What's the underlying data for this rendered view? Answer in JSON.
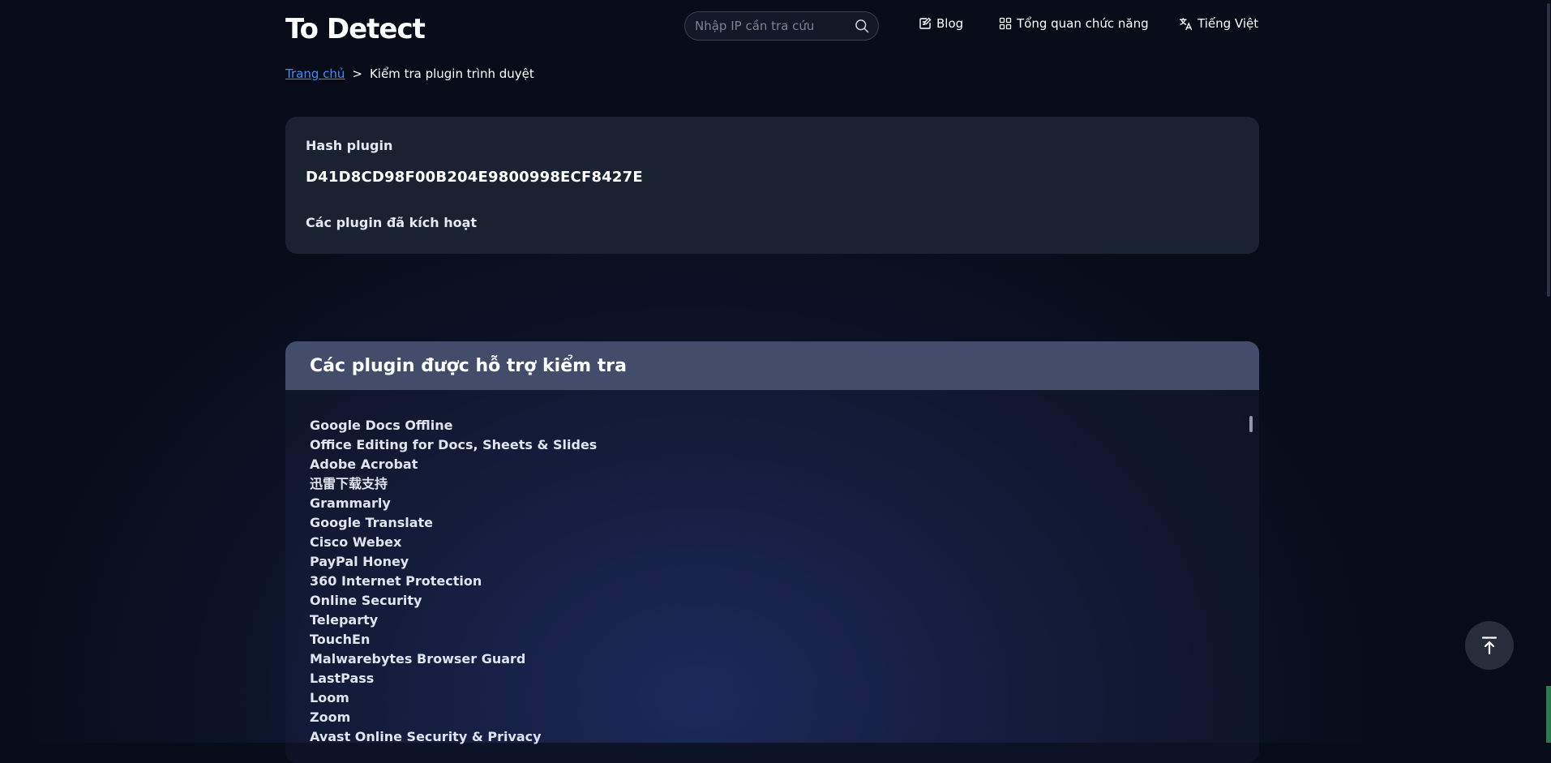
{
  "header": {
    "logo_text": "To Detect",
    "search_placeholder": "Nhập IP cần tra cứu",
    "nav": {
      "blog": "Blog",
      "features": "Tổng quan chức năng",
      "language": "Tiếng Việt"
    }
  },
  "breadcrumb": {
    "home": "Trang chủ",
    "separator": ">",
    "current": "Kiểm tra plugin trình duyệt"
  },
  "hash_card": {
    "hash_label": "Hash plugin",
    "hash_value": "D41D8CD98F00B204E9800998ECF8427E",
    "enabled_label": "Các plugin đã kích hoạt"
  },
  "supported": {
    "title": "Các plugin được hỗ trợ kiểm tra",
    "plugins": [
      "Google Docs Offline",
      "Office Editing for Docs, Sheets & Slides",
      "Adobe Acrobat",
      "迅雷下载支持",
      "Grammarly",
      "Google Translate",
      "Cisco Webex",
      "PayPal Honey",
      "360 Internet Protection",
      "Online Security",
      "Teleparty",
      "TouchEn",
      "Malwarebytes Browser Guard",
      "LastPass",
      "Loom",
      "Zoom",
      "Avast Online Security & Privacy"
    ]
  },
  "colors": {
    "accent": "#3d8dff",
    "card_bg": "#1a2130",
    "panel_header_bg": "#434c6b"
  }
}
